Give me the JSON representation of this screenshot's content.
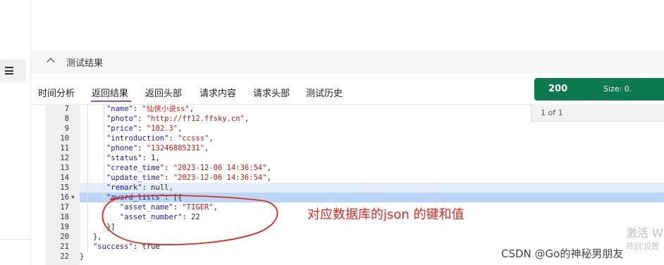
{
  "section": {
    "title": "测试结果"
  },
  "tabs": [
    {
      "label": "时间分析"
    },
    {
      "label": "返回结果"
    },
    {
      "label": "返回头部"
    },
    {
      "label": "请求内容"
    },
    {
      "label": "请求头部"
    },
    {
      "label": "测试历史"
    }
  ],
  "active_tab": "返回结果",
  "status": {
    "code": "200",
    "size_label": "Size: 0."
  },
  "pager": {
    "text": "1 of 1"
  },
  "code_lines": [
    {
      "num": "7",
      "fold": "",
      "indent": "      ",
      "key": "\"name\"",
      "sep": ": ",
      "value": "\"仙侠小说ss\"",
      "vtype": "s",
      "end": ","
    },
    {
      "num": "8",
      "fold": "",
      "indent": "      ",
      "key": "\"photo\"",
      "sep": ": ",
      "value": "\"http://ff12.ffsky.cn\"",
      "vtype": "s",
      "end": ","
    },
    {
      "num": "9",
      "fold": "",
      "indent": "      ",
      "key": "\"price\"",
      "sep": ": ",
      "value": "\"102.3\"",
      "vtype": "s",
      "end": ","
    },
    {
      "num": "10",
      "fold": "",
      "indent": "      ",
      "key": "\"introduction\"",
      "sep": ": ",
      "value": "\"ccsss\"",
      "vtype": "s",
      "end": ","
    },
    {
      "num": "11",
      "fold": "",
      "indent": "      ",
      "key": "\"phone\"",
      "sep": ": ",
      "value": "\"13246885231\"",
      "vtype": "s",
      "end": ","
    },
    {
      "num": "12",
      "fold": "",
      "indent": "      ",
      "key": "\"status\"",
      "sep": ": ",
      "value": "1",
      "vtype": "n",
      "end": ","
    },
    {
      "num": "13",
      "fold": "",
      "indent": "      ",
      "key": "\"create_time\"",
      "sep": ": ",
      "value": "\"2023-12-06 14:36:54\"",
      "vtype": "s",
      "end": ","
    },
    {
      "num": "14",
      "fold": "",
      "indent": "      ",
      "key": "\"update_time\"",
      "sep": ": ",
      "value": "\"2023-12-06 14:36:54\"",
      "vtype": "s",
      "end": ","
    },
    {
      "num": "15",
      "fold": "",
      "indent": "      ",
      "key": "\"remark\"",
      "sep": ": ",
      "value": "null",
      "vtype": "n",
      "end": ","
    },
    {
      "num": "16",
      "fold": "▼",
      "indent": "      ",
      "key": "\"award_lists\"",
      "sep": ": ",
      "value": "[{",
      "vtype": "n",
      "end": ""
    },
    {
      "num": "17",
      "fold": "",
      "indent": "         ",
      "key": "\"asset_name\"",
      "sep": ": ",
      "value": "\"TIGER\"",
      "vtype": "s",
      "end": ","
    },
    {
      "num": "18",
      "fold": "",
      "indent": "         ",
      "key": "\"asset_number\"",
      "sep": ": ",
      "value": "22",
      "vtype": "n",
      "end": ""
    },
    {
      "num": "19",
      "fold": "",
      "indent": "      ",
      "key": "",
      "sep": "",
      "value": "}]",
      "vtype": "n",
      "end": ""
    },
    {
      "num": "20",
      "fold": "",
      "indent": "   ",
      "key": "",
      "sep": "",
      "value": "},",
      "vtype": "n",
      "end": ""
    },
    {
      "num": "21",
      "fold": "",
      "indent": "   ",
      "key": "\"success\"",
      "sep": ": ",
      "value": "true",
      "vtype": "n",
      "end": ""
    },
    {
      "num": "22",
      "fold": "",
      "indent": "",
      "key": "",
      "sep": "",
      "value": "}",
      "vtype": "n",
      "end": ""
    }
  ],
  "annotation": "对应数据库的json 的键和值",
  "watermark": {
    "line1": "激活 W",
    "line2": "转到'设置"
  },
  "credit": "CSDN @Go的神秘男朋友",
  "colors": {
    "accent": "#7e5bd1",
    "status_green": "#0c7a4f",
    "annotation_red": "#e8261c"
  }
}
